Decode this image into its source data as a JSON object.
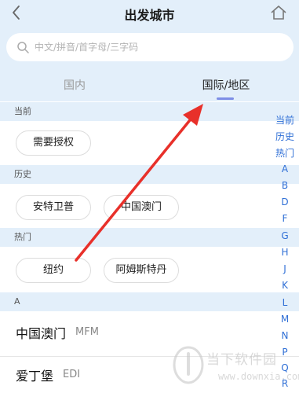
{
  "header": {
    "title": "出发城市"
  },
  "search": {
    "placeholder": "中文/拼音/首字母/三字码"
  },
  "tabs": [
    {
      "label": "国内",
      "active": false
    },
    {
      "label": "国际/地区",
      "active": true
    }
  ],
  "sections": {
    "current": {
      "title": "当前",
      "chips": [
        "需要授权"
      ]
    },
    "history": {
      "title": "历史",
      "chips": [
        "安特卫普",
        "中国澳门"
      ]
    },
    "hot": {
      "title": "热门",
      "chips": [
        "纽约",
        "阿姆斯特丹"
      ]
    },
    "a_group": {
      "title": "A",
      "cities": [
        {
          "name": "中国澳门",
          "code": "MFM"
        },
        {
          "name": "爱丁堡",
          "code": "EDI"
        }
      ]
    }
  },
  "index_bar": [
    "当前",
    "历史",
    "热门",
    "A",
    "B",
    "D",
    "F",
    "G",
    "H",
    "J",
    "K",
    "L",
    "M",
    "N",
    "P",
    "Q",
    "R"
  ],
  "watermark": {
    "main": "当下软件园",
    "sub": "www.downxia.com"
  },
  "colors": {
    "header_bg": "#e3effa",
    "accent": "#7d8ee6",
    "index_text": "#2f6fd6",
    "annotation_arrow": "#e8302a"
  },
  "icons": {
    "back": "chevron-left-icon",
    "home": "home-icon",
    "search": "search-icon"
  }
}
